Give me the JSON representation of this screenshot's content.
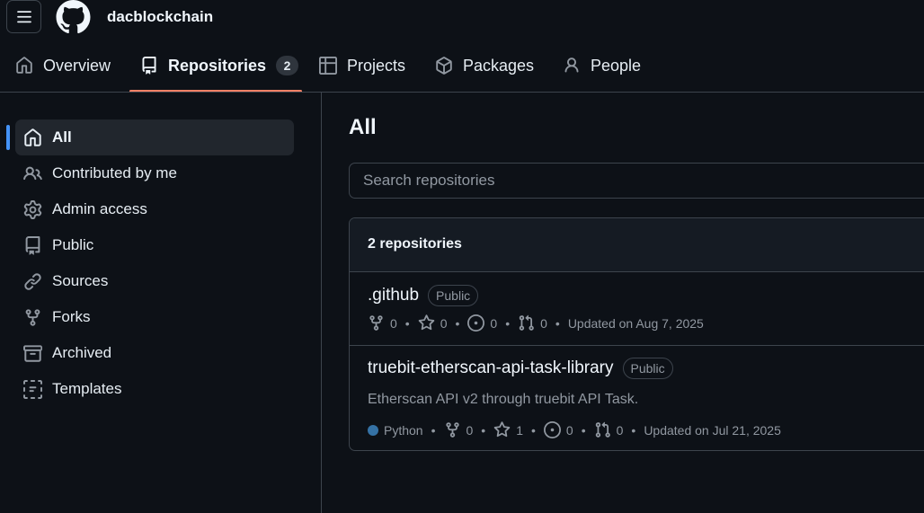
{
  "header": {
    "org_name": "dacblockchain"
  },
  "tabs": [
    {
      "label": "Overview",
      "icon": "home-icon"
    },
    {
      "label": "Repositories",
      "icon": "repo-icon",
      "count": "2",
      "active": true
    },
    {
      "label": "Projects",
      "icon": "table-icon"
    },
    {
      "label": "Packages",
      "icon": "package-icon"
    },
    {
      "label": "People",
      "icon": "person-icon"
    }
  ],
  "sidebar": {
    "items": [
      {
        "label": "All",
        "icon": "home-icon",
        "active": true
      },
      {
        "label": "Contributed by me",
        "icon": "people-icon"
      },
      {
        "label": "Admin access",
        "icon": "gear-icon"
      },
      {
        "label": "Public",
        "icon": "repo-icon"
      },
      {
        "label": "Sources",
        "icon": "link-icon"
      },
      {
        "label": "Forks",
        "icon": "fork-icon"
      },
      {
        "label": "Archived",
        "icon": "archive-icon"
      },
      {
        "label": "Templates",
        "icon": "template-icon"
      }
    ]
  },
  "main": {
    "title": "All",
    "search_placeholder": "Search repositories",
    "repo_count": "2 repositories",
    "repos": [
      {
        "name": ".github",
        "visibility": "Public",
        "forks": "0",
        "stars": "0",
        "issues": "0",
        "pulls": "0",
        "updated": "Updated on Aug 7, 2025"
      },
      {
        "name": "truebit-etherscan-api-task-library",
        "visibility": "Public",
        "description": "Etherscan API v2 through truebit API Task.",
        "language": "Python",
        "language_color": "#3572a5",
        "forks": "0",
        "stars": "1",
        "issues": "0",
        "pulls": "0",
        "updated": "Updated on Jul 21, 2025"
      }
    ]
  },
  "colors": {
    "accent_underline": "#f78166",
    "active_marker": "#4493f8",
    "background": "#0d1117"
  }
}
